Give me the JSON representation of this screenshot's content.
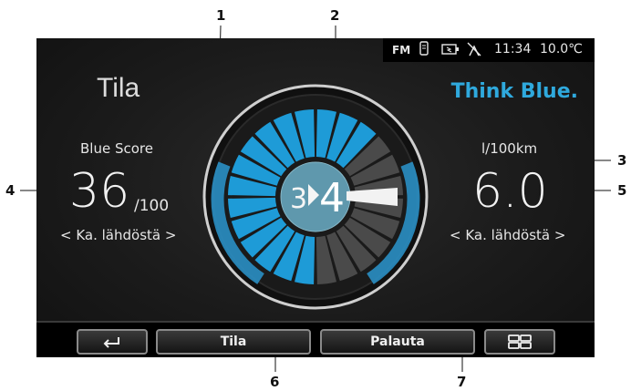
{
  "callouts": {
    "c1": "1",
    "c2": "2",
    "c3": "3",
    "c4": "4",
    "c5": "5",
    "c6": "6",
    "c7": "7"
  },
  "status": {
    "fm": "FM",
    "time": "11:34",
    "temp": "10.0℃"
  },
  "title": "Tila",
  "brand": "Think Blue.",
  "left": {
    "label": "Blue Score",
    "value": "36",
    "suffix": "/100",
    "nav": "< Ka. lähdöstä >"
  },
  "right": {
    "label": "l/100km",
    "value": "6.0",
    "nav": "< Ka. lähdöstä >"
  },
  "gear": {
    "current": "3",
    "recommended": "4"
  },
  "gauge": {
    "segments_total": 24,
    "colors": {
      "accent": "#1e9bd7",
      "dim": "#4a4a4a"
    }
  },
  "buttons": {
    "tila": "Tila",
    "palauta": "Palauta"
  },
  "icons": [
    "back-icon",
    "grid-icon",
    "phone-icon",
    "battery-icon",
    "satellite-icon"
  ]
}
